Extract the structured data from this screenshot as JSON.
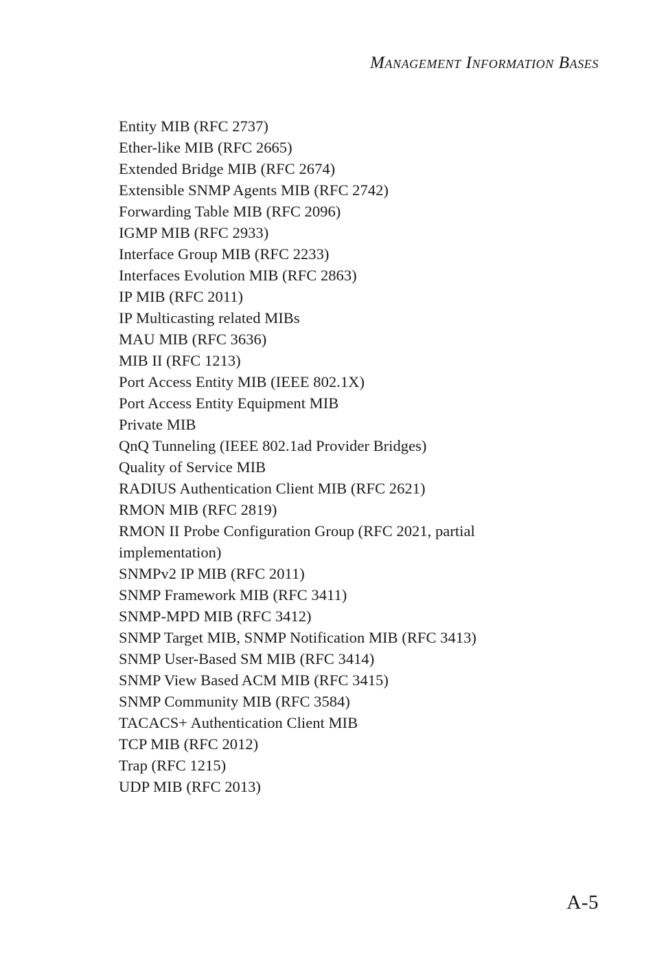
{
  "header": {
    "running_head": "Management Information Bases"
  },
  "body": {
    "lines": [
      "Entity MIB (RFC 2737)",
      "Ether-like MIB (RFC 2665)",
      "Extended Bridge MIB (RFC 2674)",
      "Extensible SNMP Agents MIB (RFC 2742)",
      "Forwarding Table MIB (RFC 2096)",
      "IGMP MIB (RFC 2933)",
      "Interface Group MIB (RFC 2233)",
      "Interfaces Evolution MIB (RFC 2863)",
      "IP MIB (RFC 2011)",
      "IP Multicasting related MIBs",
      "MAU MIB (RFC 3636)",
      "MIB II (RFC 1213)",
      "Port Access Entity MIB (IEEE 802.1X)",
      "Port Access Entity Equipment MIB",
      "Private MIB",
      "QnQ Tunneling (IEEE 802.1ad Provider Bridges)",
      "Quality of Service MIB",
      "RADIUS Authentication Client MIB (RFC 2621)",
      "RMON MIB (RFC 2819)",
      "RMON II Probe Configuration Group (RFC 2021, partial",
      "implementation)",
      "SNMPv2 IP MIB (RFC 2011)",
      "SNMP Framework MIB (RFC 3411)",
      "SNMP-MPD MIB (RFC 3412)",
      "SNMP Target MIB, SNMP Notification MIB (RFC 3413)",
      "SNMP User-Based SM MIB (RFC 3414)",
      "SNMP View Based ACM MIB (RFC 3415)",
      "SNMP Community MIB (RFC 3584)",
      "TACACS+ Authentication Client MIB",
      "TCP MIB (RFC 2012)",
      "Trap (RFC 1215)",
      "UDP MIB (RFC 2013)"
    ]
  },
  "footer": {
    "page_number": "A-5"
  }
}
